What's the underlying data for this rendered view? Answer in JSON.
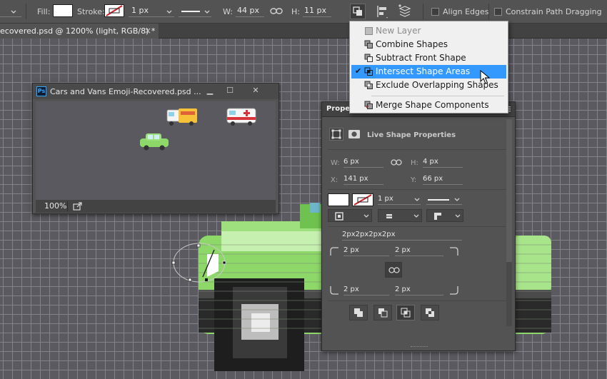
{
  "options_bar": {
    "fill_label": "Fill:",
    "stroke_label": "Stroke:",
    "stroke_width": "1 px",
    "w_label": "W:",
    "w_value": "44 px",
    "h_label": "H:",
    "h_value": "11 px",
    "align_edges_label": "Align Edges",
    "constrain_label": "Constrain Path Dragging"
  },
  "tab": {
    "title": "ecovered.psd @ 1200% (light, RGB/8) *",
    "close": "×"
  },
  "doc_window": {
    "title": "Cars and Vans Emoji-Recovered.psd ...",
    "zoom": "100%",
    "min": "▁",
    "max": "☐",
    "close": "✕",
    "ps_logo": "Ps"
  },
  "path_menu": {
    "items": [
      {
        "label": "New Layer",
        "icon": "new-layer-icon",
        "disabled": true
      },
      {
        "label": "Combine Shapes",
        "icon": "combine-shapes-icon"
      },
      {
        "label": "Subtract Front Shape",
        "icon": "subtract-front-icon"
      },
      {
        "label": "Intersect Shape Areas",
        "icon": "intersect-areas-icon",
        "checked": true
      },
      {
        "label": "Exclude Overlapping Shapes",
        "icon": "exclude-overlap-icon"
      },
      {
        "label": "Merge Shape Components",
        "icon": "merge-components-icon"
      }
    ],
    "check": "✔"
  },
  "properties": {
    "title": "Properties",
    "subtitle": "Live Shape Properties",
    "w_label": "W:",
    "w_value": "6 px",
    "h_label": "H:",
    "h_value": "4 px",
    "x_label": "X:",
    "x_value": "141 px",
    "y_label": "Y:",
    "y_value": "66 px",
    "stroke_width": "1 px",
    "corner_summary": "2px2px2px2px",
    "corners": [
      "2 px",
      "2 px",
      "2 px",
      "2 px"
    ]
  },
  "colors": {
    "accent": "#3399ff",
    "car_green": "#8ed86a",
    "panel_bg": "#535353"
  }
}
